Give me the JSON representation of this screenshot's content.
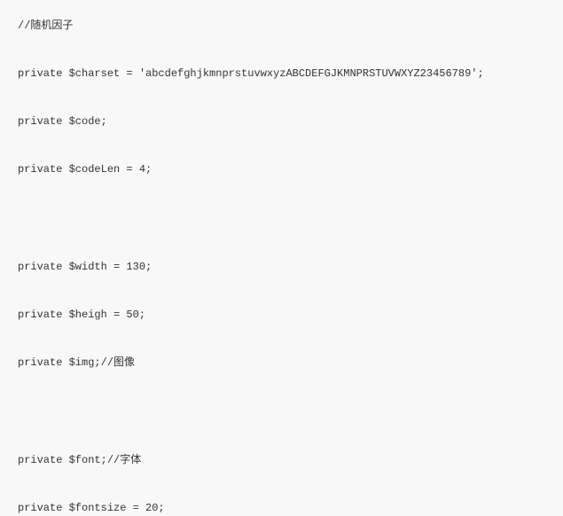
{
  "code": {
    "lines": [
      {
        "text": "//随机因子",
        "gap": "normal"
      },
      {
        "text": "private $charset = 'abcdefghjkmnprstuvwxyzABCDEFGJKMNPRSTUVWXYZ23456789';",
        "gap": "normal"
      },
      {
        "text": "private $code;",
        "gap": "normal"
      },
      {
        "text": "private $codeLen = 4;",
        "gap": "tall"
      },
      {
        "text": "private $width = 130;",
        "gap": "normal"
      },
      {
        "text": "private $heigh = 50;",
        "gap": "normal"
      },
      {
        "text": "private $img;//图像",
        "gap": "tall"
      },
      {
        "text": "private $font;//字体",
        "gap": "normal"
      },
      {
        "text": "private $fontsize = 20;",
        "gap": "normal"
      }
    ]
  }
}
